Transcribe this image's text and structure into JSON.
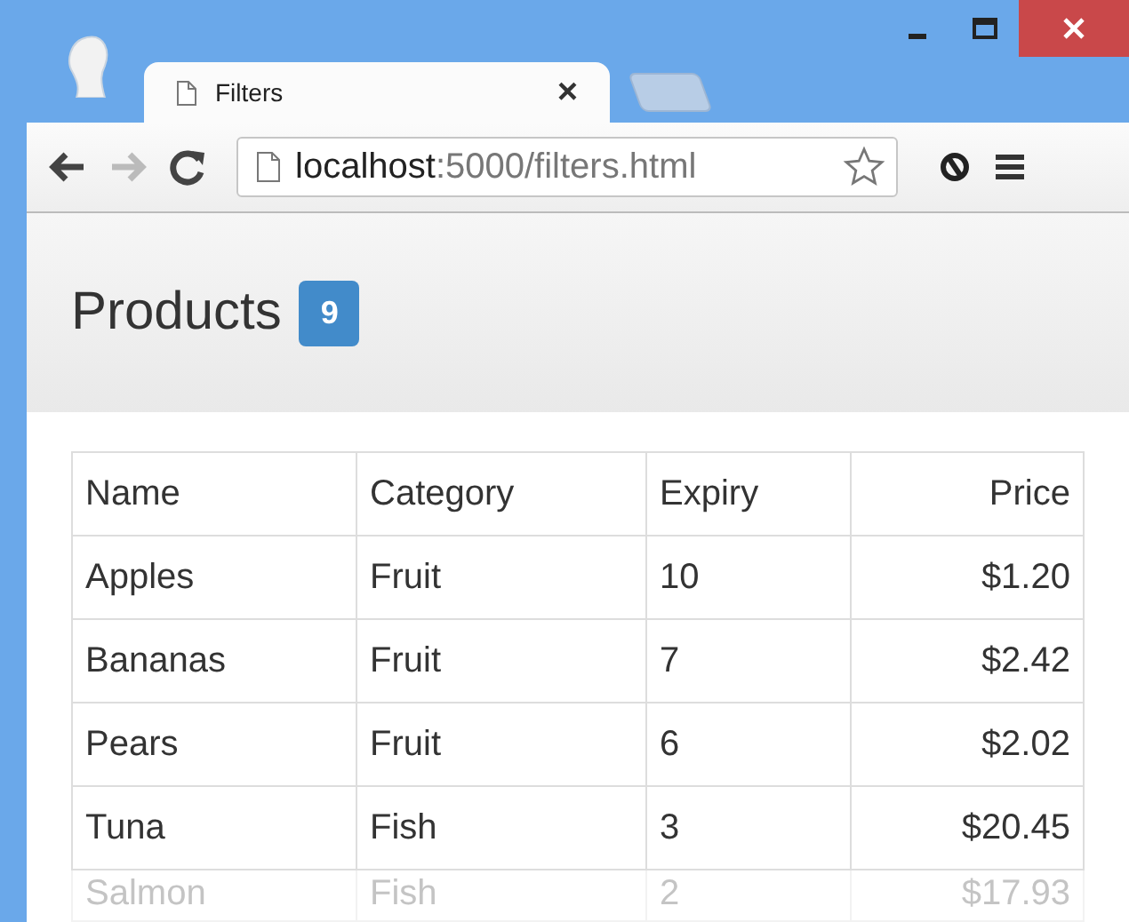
{
  "browser": {
    "tabs": [
      {
        "title": "Filters",
        "close": "×",
        "selected": true
      }
    ],
    "address": {
      "host": "localhost",
      "rest": ":5000/filters.html"
    }
  },
  "page": {
    "heading": "Products",
    "badge": "9"
  },
  "table": {
    "columns": [
      {
        "label": "Name",
        "kind": "text"
      },
      {
        "label": "Category",
        "kind": "text"
      },
      {
        "label": "Expiry",
        "kind": "text"
      },
      {
        "label": "Price",
        "kind": "money"
      }
    ],
    "rows": [
      {
        "cells": [
          "Apples",
          "Fruit",
          "10",
          "$1.20"
        ],
        "faded": false
      },
      {
        "cells": [
          "Bananas",
          "Fruit",
          "7",
          "$2.42"
        ],
        "faded": false
      },
      {
        "cells": [
          "Pears",
          "Fruit",
          "6",
          "$2.02"
        ],
        "faded": false
      },
      {
        "cells": [
          "Tuna",
          "Fish",
          "3",
          "$20.45"
        ],
        "faded": false
      },
      {
        "cells": [
          "Salmon",
          "Fish",
          "2",
          "$17.93"
        ],
        "faded": true
      }
    ]
  }
}
